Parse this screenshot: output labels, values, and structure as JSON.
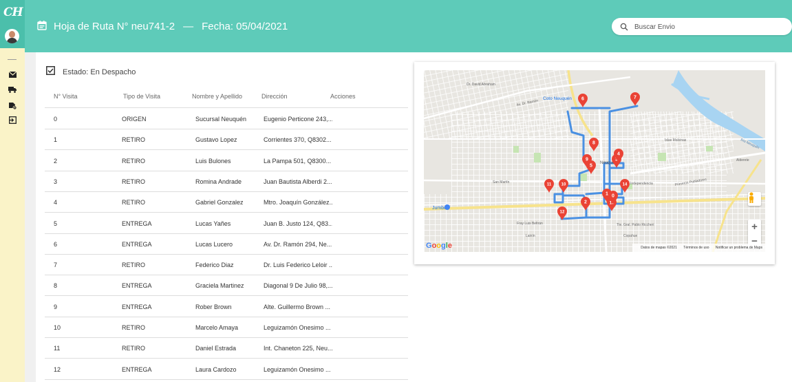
{
  "sidebar": {
    "logo_text": "CH",
    "icons": [
      "mail-icon",
      "truck-icon",
      "settings-icon",
      "logout-icon"
    ]
  },
  "header": {
    "route_label": "Hoja de Ruta N° neu741-2",
    "separator": "—",
    "date_label": "Fecha: 05/04/2021"
  },
  "search": {
    "placeholder": "Buscar Envio"
  },
  "status": {
    "label": "Estado: En Despacho"
  },
  "table": {
    "headers": [
      "N° Visita",
      "Tipo de Visita",
      "Nombre y Apellido",
      "Dirección",
      "Acciones"
    ],
    "rows": [
      {
        "num": "0",
        "type": "ORIGEN",
        "name": "Sucursal Neuquén",
        "address": "Eugenio Perticone 243,..."
      },
      {
        "num": "1",
        "type": "RETIRO",
        "name": "Gustavo Lopez",
        "address": "Corrientes 370, Q8302..."
      },
      {
        "num": "2",
        "type": "RETIRO",
        "name": "Luis Bulones",
        "address": "La Pampa 501, Q8300..."
      },
      {
        "num": "3",
        "type": "RETIRO",
        "name": "Romina Andrade",
        "address": "Juan Bautista Alberdi 2..."
      },
      {
        "num": "4",
        "type": "RETIRO",
        "name": "Gabriel Gonzalez",
        "address": "Mtro. Joaquín González..."
      },
      {
        "num": "5",
        "type": "ENTREGA",
        "name": "Lucas Yañes",
        "address": "Juan B. Justo 124, Q83..."
      },
      {
        "num": "6",
        "type": "ENTREGA",
        "name": "Lucas Lucero",
        "address": "Av. Dr. Ramón 294, Ne..."
      },
      {
        "num": "7",
        "type": "RETIRO",
        "name": "Federico Diaz",
        "address": "Dr. Luis Federico Leloir ..."
      },
      {
        "num": "8",
        "type": "ENTREGA",
        "name": "Graciela Martinez",
        "address": "Diagonal 9 De Julio 98,..."
      },
      {
        "num": "9",
        "type": "ENTREGA",
        "name": "Rober Brown",
        "address": "Alte. Guillermo Brown ..."
      },
      {
        "num": "10",
        "type": "RETIRO",
        "name": "Marcelo Amaya",
        "address": "Leguizamón Onesimo ..."
      },
      {
        "num": "11",
        "type": "RETIRO",
        "name": "Daniel Estrada",
        "address": "Int. Chaneton 225, Neu..."
      },
      {
        "num": "12",
        "type": "ENTREGA",
        "name": "Laura Cardozo",
        "address": "Leguizamón Onesimo ..."
      }
    ]
  },
  "map": {
    "labels": {
      "coto": "Coto Neuquén",
      "jumbo": "Jumbo",
      "islas": "Islas Malvinas",
      "rio": "Río Neuquén",
      "alderete": "Alderete",
      "san_martin": "San Martín",
      "independencia": "Independencia",
      "primeros": "Primeros Pobladores",
      "tte_richieri": "Tte. Gral. Pablo Riccheri",
      "fray": "Fray Luis Beltrán",
      "lainin": "Lainín",
      "copahue": "Copahue",
      "david": "Dr. David Abraham",
      "ramon": "Av. Dr. Ramón",
      "neuquen": "Neuquén"
    },
    "markers": [
      "1",
      "2",
      "3",
      "4",
      "5",
      "6",
      "7",
      "8",
      "9",
      "10",
      "11",
      "12",
      "13",
      "14",
      "0"
    ],
    "google": "Google",
    "attribution": {
      "data": "Datos de mapas ©2021",
      "terms": "Términos de uso",
      "report": "Notificar un problema de Maps"
    },
    "zoom_in": "+",
    "zoom_out": "−",
    "route_color": "#4a90e2",
    "marker_color": "#ea4335"
  },
  "colors": {
    "header_bg": "#5ecbb9",
    "sidebar_top": "#4bbfab",
    "sidebar_bg": "#faf3c8"
  }
}
